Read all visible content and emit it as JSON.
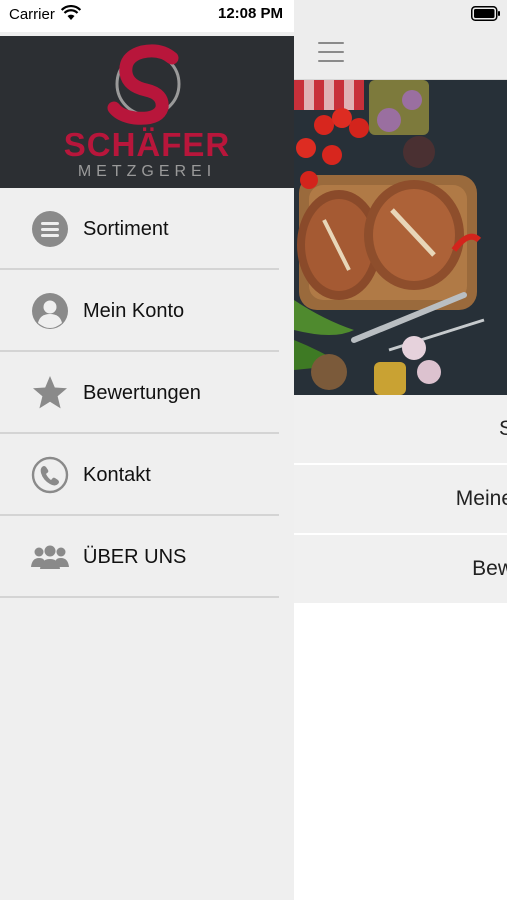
{
  "status_bar": {
    "carrier": "Carrier",
    "time": "12:08 PM"
  },
  "brand": {
    "name": "SCHÄFER",
    "subtitle": "METZGEREI"
  },
  "drawer_menu": [
    {
      "label": "Sortiment",
      "icon": "list-icon"
    },
    {
      "label": "Mein Konto",
      "icon": "user-icon"
    },
    {
      "label": "Bewertungen",
      "icon": "star-icon"
    },
    {
      "label": "Kontakt",
      "icon": "phone-icon"
    },
    {
      "label": "ÜBER UNS",
      "icon": "group-icon"
    }
  ],
  "main_list": [
    "S",
    "Meine",
    "Bew"
  ],
  "colors": {
    "brand_red": "#b8163b",
    "icon_gray": "#8a8a8a",
    "drawer_bg": "#efefef",
    "header_bg": "#2c2f33"
  }
}
